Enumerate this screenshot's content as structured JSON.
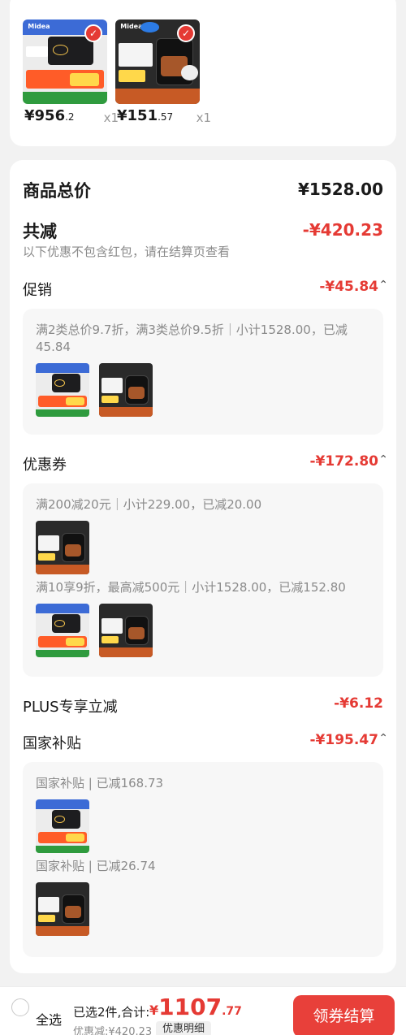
{
  "cart_items": [
    {
      "price_int": "¥956",
      "price_dec": ".2",
      "qty": "x1",
      "brand": "Midea"
    },
    {
      "price_int": "¥151",
      "price_dec": ".57",
      "qty": "x1",
      "brand": "Midea"
    }
  ],
  "summary": {
    "total_label": "商品总价",
    "total_value": "¥1528.00",
    "reduce_label": "共减",
    "reduce_value": "-¥420.23",
    "note": "以下优惠不包含红包，请在结算页查看",
    "sections": {
      "promo": {
        "label": "促销",
        "value": "-¥45.84",
        "rules": [
          "满2类总价9.7折，满3类总价9.5折｜小计1528.00，已减45.84"
        ]
      },
      "coupon": {
        "label": "优惠券",
        "value": "-¥172.80",
        "rules": [
          "满200减20元｜小计229.00，已减20.00",
          "满10享9折，最高减500元｜小计1528.00，已减152.80"
        ]
      },
      "plus": {
        "label": "PLUS专享立减",
        "value": "-¥6.12"
      },
      "subsidy": {
        "label": "国家补贴",
        "value": "-¥195.47",
        "rules": [
          "国家补贴 | 已减168.73",
          "国家补贴 | 已减26.74"
        ]
      }
    }
  },
  "bottom_bar": {
    "select_all": "全选",
    "selected_text": "已选2件,合计:",
    "currency": "¥",
    "total_int": "1107",
    "total_dec": ".77",
    "saved": "优惠减:¥420.23",
    "detail_button": "优惠明细",
    "checkout_button": "领券结算"
  },
  "icons": {
    "checked": "check-circle-icon",
    "collapse": "chevron-up-icon",
    "radio": "radio-unchecked-icon"
  },
  "colors": {
    "accent_red": "#e53a34",
    "checkout_bg": "#e8403a",
    "muted_text": "#8a8a8a"
  }
}
